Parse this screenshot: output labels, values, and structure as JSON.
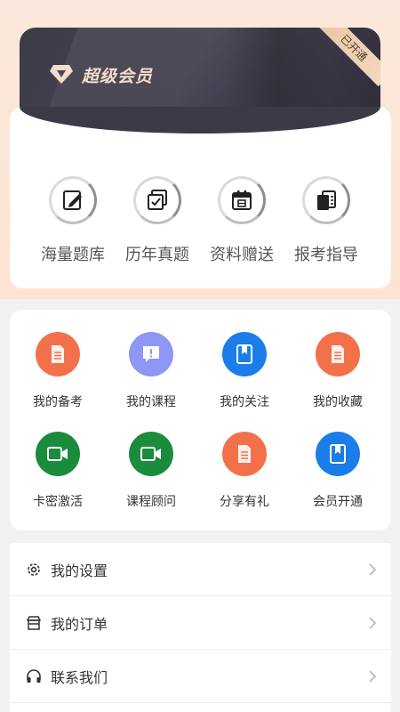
{
  "vip": {
    "title": "超级会员",
    "badge": "已开通",
    "features": [
      {
        "label": "海量题库",
        "icon": "pencil-note-icon"
      },
      {
        "label": "历年真题",
        "icon": "stacked-check-icon"
      },
      {
        "label": "资料赠送",
        "icon": "calendar-icon"
      },
      {
        "label": "报考指导",
        "icon": "documents-icon"
      }
    ]
  },
  "grid": {
    "items": [
      {
        "label": "我的备考",
        "icon": "document-icon",
        "color": "#f2714a"
      },
      {
        "label": "我的课程",
        "icon": "message-alert-icon",
        "color": "#8e97f3"
      },
      {
        "label": "我的关注",
        "icon": "bookmark-book-icon",
        "color": "#1a7de8"
      },
      {
        "label": "我的收藏",
        "icon": "document-icon",
        "color": "#f2714a"
      },
      {
        "label": "卡密激活",
        "icon": "video-camera-icon",
        "color": "#1a8c3c"
      },
      {
        "label": "课程顾问",
        "icon": "video-camera-icon",
        "color": "#1a8c3c"
      },
      {
        "label": "分享有礼",
        "icon": "document-icon",
        "color": "#f2714a"
      },
      {
        "label": "会员开通",
        "icon": "bookmark-book-icon",
        "color": "#1a7de8"
      }
    ]
  },
  "menu": {
    "items": [
      {
        "label": "我的设置",
        "icon": "gear-icon"
      },
      {
        "label": "我的订单",
        "icon": "shop-icon"
      },
      {
        "label": "联系我们",
        "icon": "headphones-icon"
      }
    ]
  },
  "colors": {
    "top_bg": "#fde3d2",
    "card_dark": "#3d3a47",
    "vip_gold": "#f3dcc9"
  }
}
